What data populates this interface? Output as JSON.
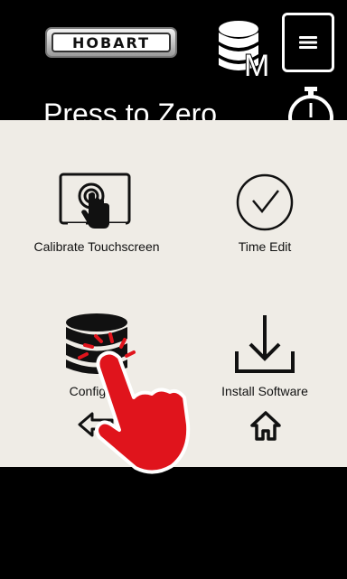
{
  "header": {
    "brand_logo_text": "HOBART",
    "db_badge_letter": "M",
    "title": "Press to Zero"
  },
  "menu": {
    "items": [
      {
        "label": "Calibrate Touchscreen",
        "icon": "touchscreen-icon"
      },
      {
        "label": "Time Edit",
        "icon": "clock-icon"
      },
      {
        "label": "Configure",
        "icon": "database-icon"
      },
      {
        "label": "Install Software",
        "icon": "download-icon"
      }
    ]
  },
  "nav": {
    "back_icon": "back-arrow-icon",
    "home_icon": "home-icon"
  },
  "colors": {
    "background": "#000000",
    "panel": "#efece6",
    "hand": "#e0141c"
  }
}
